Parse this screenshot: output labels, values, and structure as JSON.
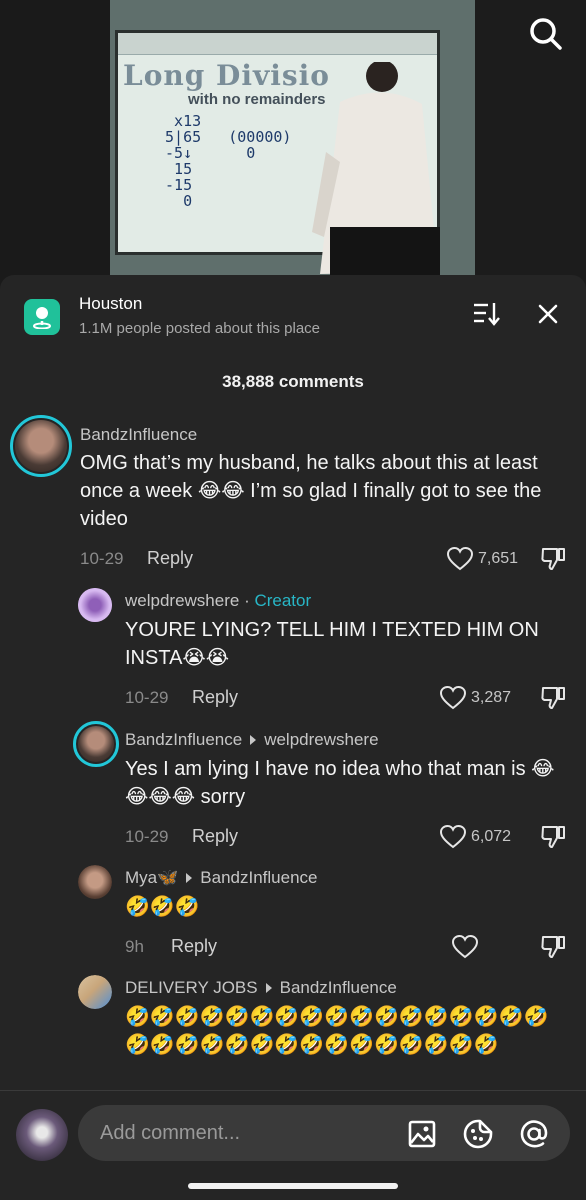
{
  "video": {
    "lesson_title": "Long Divisio",
    "lesson_subtitle": "with no remainders",
    "math": "  x13\n 5|65   (00000)\n -5↓      0\n  15\n -15\n   0"
  },
  "location": {
    "name": "Houston",
    "subtitle": "1.1M people posted about this place"
  },
  "comments_count": "38,888 comments",
  "comments": [
    {
      "username": "BandzInfluence",
      "text": "OMG that’s my husband, he talks about this at least once a week 😂😂 I’m so glad I finally got to see the video",
      "date": "10-29",
      "reply_label": "Reply",
      "likes": "7,651"
    },
    {
      "username": "welpdrewshere",
      "badge": "Creator",
      "separator": " · ",
      "text": "YOURE LYING? TELL HIM I TEXTED HIM ON INSTA😭😭",
      "date": "10-29",
      "reply_label": "Reply",
      "likes": "3,287"
    },
    {
      "username": "BandzInfluence",
      "reply_to": "welpdrewshere",
      "text": "Yes I am lying I have no idea who that man is 😂😂😂😂 sorry",
      "date": "10-29",
      "reply_label": "Reply",
      "likes": "6,072"
    },
    {
      "username": "Mya🦋",
      "reply_to": "BandzInfluence",
      "text": "🤣🤣🤣",
      "date": "9h",
      "reply_label": "Reply",
      "likes": ""
    },
    {
      "username": "DELIVERY JOBS",
      "reply_to": "BandzInfluence",
      "text": "🤣🤣🤣🤣🤣🤣🤣🤣🤣🤣🤣🤣🤣🤣🤣🤣🤣🤣🤣🤣🤣🤣🤣🤣🤣🤣🤣🤣🤣🤣🤣🤣"
    }
  ],
  "input": {
    "placeholder": "Add comment..."
  },
  "icons": {
    "search": "search-icon",
    "location": "location-pin-icon",
    "sort": "sort-icon",
    "close": "close-icon",
    "like": "heart-icon",
    "dislike": "thumbs-down-icon",
    "image": "image-icon",
    "emoji": "emoji-icon",
    "mention": "at-sign-icon"
  },
  "colors": {
    "sheet_bg": "#252525",
    "accent": "#28b6c6",
    "place_icon": "#20c19a"
  }
}
